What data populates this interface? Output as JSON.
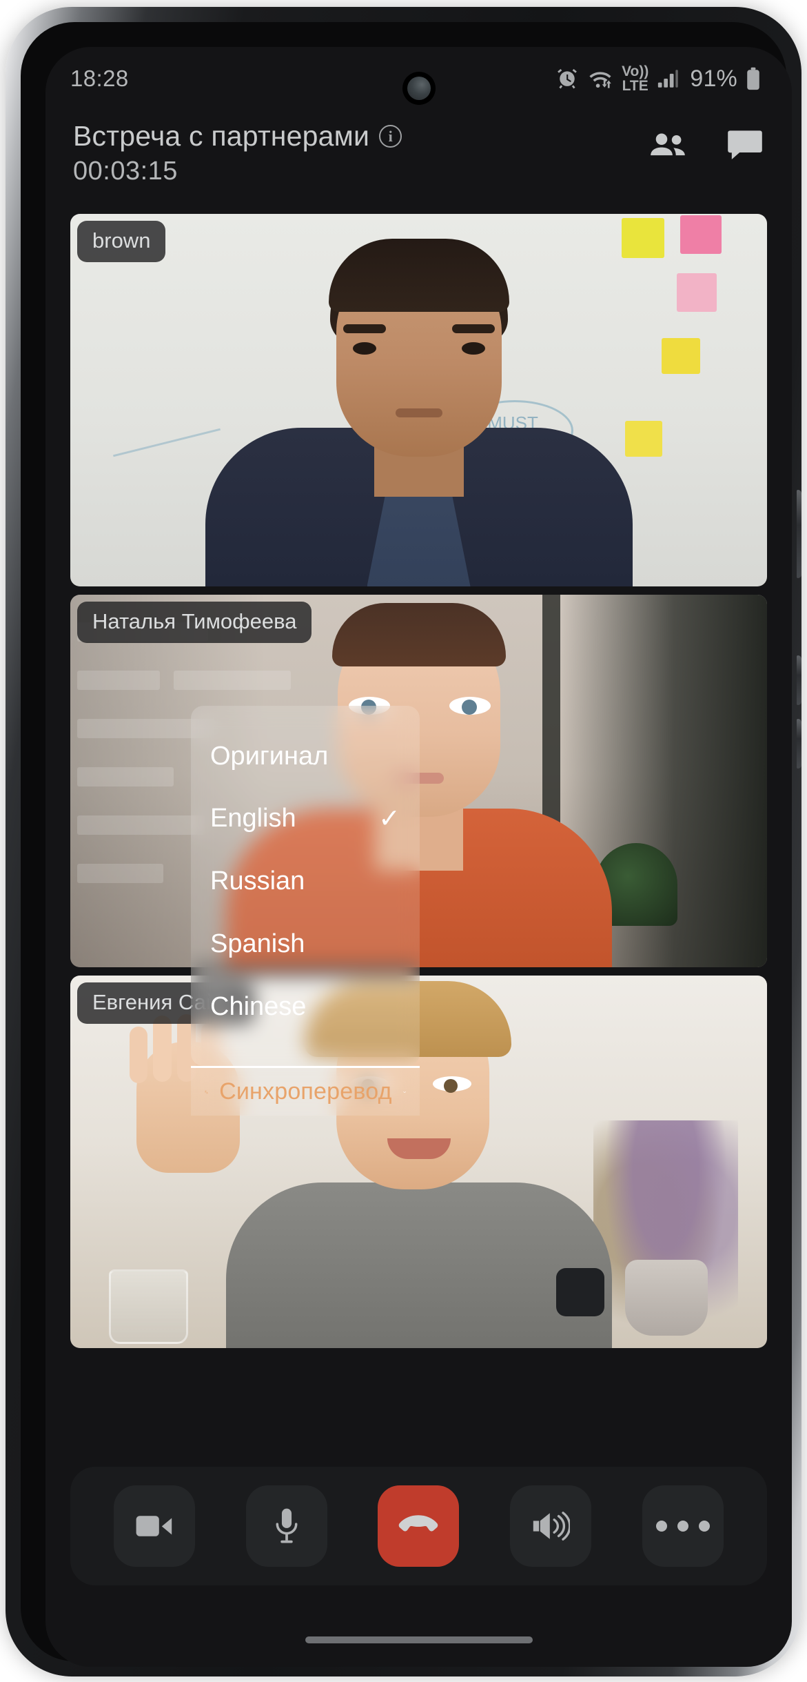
{
  "status_bar": {
    "time": "18:28",
    "battery_percent": "91%",
    "icons": [
      "alarm-icon",
      "wifi-icon",
      "volte-icon",
      "signal-icon",
      "battery-icon"
    ],
    "volte_top": "Vo))",
    "volte_bottom": "LTE"
  },
  "header": {
    "meeting_title": "Встреча с партнерами",
    "timer": "00:03:15",
    "info_icon": "info-icon",
    "participants_icon": "participants-icon",
    "chat_icon": "chat-icon"
  },
  "tiles": [
    {
      "name": "brown"
    },
    {
      "name": "Наталья Тимофеева"
    },
    {
      "name": "Евгения Сайко"
    }
  ],
  "language_menu": {
    "items": [
      {
        "label": "Оригинал",
        "selected": false
      },
      {
        "label": "English",
        "selected": true
      },
      {
        "label": "Russian",
        "selected": false
      },
      {
        "label": "Spanish",
        "selected": false
      },
      {
        "label": "Chinese",
        "selected": false
      }
    ],
    "check_glyph": "✓"
  },
  "sync_translate": {
    "label": "Синхроперевод",
    "icon": "translate-icon",
    "chevron": "chevron-down-icon",
    "accent_color": "#e8a36a"
  },
  "controls": [
    {
      "name": "camera-button",
      "icon": "video-camera-icon",
      "style": "normal"
    },
    {
      "name": "microphone-button",
      "icon": "microphone-icon",
      "style": "normal"
    },
    {
      "name": "end-call-button",
      "icon": "hangup-phone-icon",
      "style": "danger"
    },
    {
      "name": "speaker-button",
      "icon": "speaker-icon",
      "style": "normal"
    },
    {
      "name": "more-options-button",
      "icon": "ellipsis-icon",
      "style": "normal"
    }
  ],
  "colors": {
    "danger": "#c03c2c",
    "panel": "#1a1b1d",
    "screen_bg": "#141416",
    "text": "#c9cbcc"
  }
}
